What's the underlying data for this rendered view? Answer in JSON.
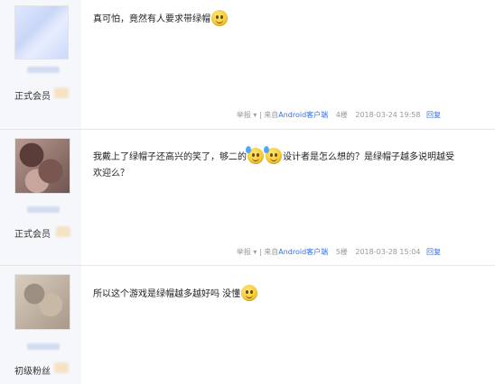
{
  "posts": [
    {
      "rank": "正式会员",
      "content": "真可怕，竟然有人要求带绿帽",
      "report": "举报",
      "source_prefix": "| 来自",
      "source_link": "Android客户端",
      "floor": "4楼",
      "time": "2018-03-24 19:58",
      "reply": "回复"
    },
    {
      "rank": "正式会员",
      "content_a": "我戴上了绿帽子还高兴的笑了，够二的",
      "content_b": "设计者是怎么想的？是绿帽子越多说明越受",
      "content_c": "欢迎么？",
      "report": "举报",
      "source_prefix": "| 来自",
      "source_link": "Android客户端",
      "floor": "5楼",
      "time": "2018-03-28 15:04",
      "reply": "回复"
    },
    {
      "rank": "初级粉丝",
      "content": "所以这个游戏是绿帽越多越好吗 没懂"
    }
  ],
  "colors": {
    "link": "#3a6fd3",
    "sidebar": "#f5f7fb",
    "meta": "#999999"
  },
  "icons": [
    "plus-logo-icon",
    "smile-emoji-icon",
    "sweat-emoji-icon",
    "dropdown-caret-icon"
  ]
}
